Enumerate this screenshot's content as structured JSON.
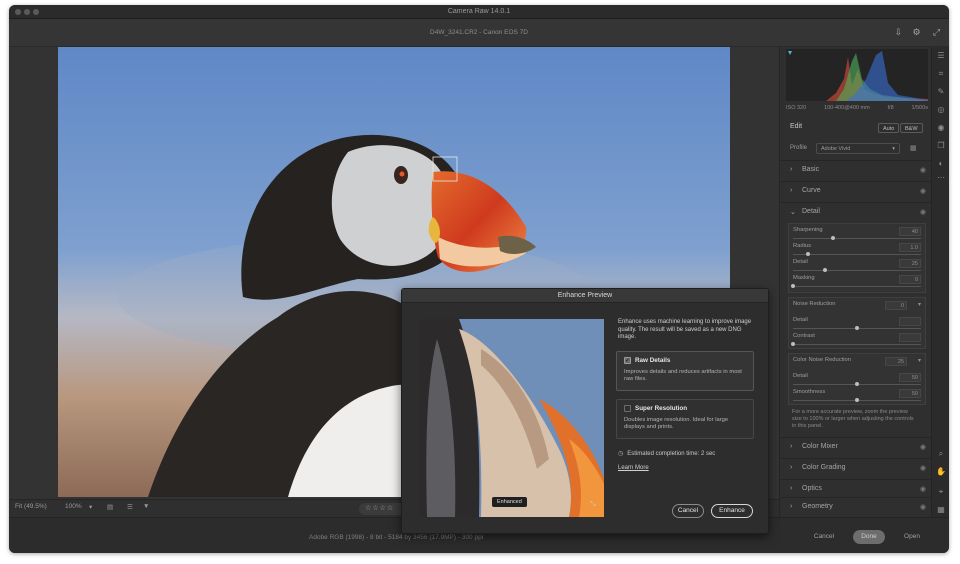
{
  "app": {
    "title": "Camera Raw 14.0.1",
    "file_label": "D4W_3241.CR2  -  Canon EOS 7D"
  },
  "histogram_info": {
    "f": "ISO 320",
    "lens": "100-400@400 mm",
    "ap": "f/8",
    "shutter": "1/500s"
  },
  "edit": {
    "label": "Edit",
    "auto_label": "Auto",
    "bw_label": "B&W",
    "profile_label": "Profile",
    "profile_value": "Adobe Vivid"
  },
  "sections": [
    {
      "name": "Basic"
    },
    {
      "name": "Curve"
    },
    {
      "name": "Detail"
    },
    {
      "name": "Color Mixer"
    },
    {
      "name": "Color Grading"
    },
    {
      "name": "Optics"
    },
    {
      "name": "Geometry"
    }
  ],
  "detail": {
    "sharpening": {
      "label": "Sharpening",
      "value": "40",
      "level": 0.31
    },
    "radius": {
      "label": "Radius",
      "value": "1.0",
      "level": 0.12
    },
    "detail": {
      "label": "Detail",
      "value": "25",
      "level": 0.25
    },
    "masking": {
      "label": "Masking",
      "value": "0",
      "level": 0.0
    },
    "noise": {
      "label": "Noise Reduction",
      "value": "0",
      "level": 0.0
    },
    "nr_detail": {
      "label": "Detail",
      "value": "",
      "level": 0.5
    },
    "nr_contrast": {
      "label": "Contrast",
      "value": "",
      "level": 0.0
    },
    "color_noise": {
      "label": "Color Noise Reduction",
      "value": "25",
      "level": 0.25
    },
    "cn_detail": {
      "label": "Detail",
      "value": "50",
      "level": 0.5
    },
    "cn_smoothness": {
      "label": "Smoothness",
      "value": "50",
      "level": 0.5
    },
    "hint": "For a more accurate preview, zoom the preview size to 100% or larger when adjusting the controls in this panel."
  },
  "bottombar": {
    "fit": "Fit (49.5%)",
    "zoom": "100%"
  },
  "footer": {
    "meta": "Adobe RGB (1998) - 8 bit - 5184 by 3456 (17.9MP) - 300 ppi",
    "cancel": "Cancel",
    "done": "Done",
    "open": "Open"
  },
  "dialog": {
    "title": "Enhance Preview",
    "description": "Enhance uses machine learning to improve image quality. The result will be saved as a new DNG image.",
    "option1_title": "Raw Details",
    "option1_desc": "Improves details and reduces artifacts in most raw files.",
    "option2_title": "Super Resolution",
    "option2_desc": "Doubles image resolution. Ideal for large displays and prints.",
    "estimate": "Estimated completion time: 2 sec",
    "learn_more": "Learn More",
    "preview_label": "Enhanced",
    "cancel": "Cancel",
    "enhance": "Enhance"
  },
  "icons": {
    "eye": "eye-icon",
    "chevron": "chevron-icon"
  }
}
